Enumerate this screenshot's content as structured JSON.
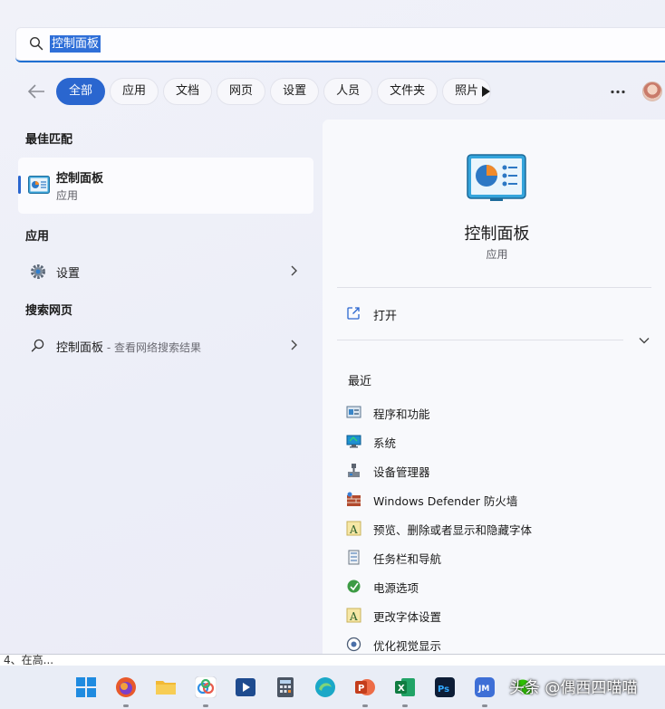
{
  "search": {
    "query": "控制面板"
  },
  "filters": {
    "tabs": [
      "全部",
      "应用",
      "文档",
      "网页",
      "设置",
      "人员",
      "文件夹",
      "照片"
    ],
    "active_index": 0
  },
  "left": {
    "best_match_title": "最佳匹配",
    "best_match": {
      "name": "控制面板",
      "type": "应用"
    },
    "apps_title": "应用",
    "apps": [
      {
        "name": "设置",
        "icon": "gear-icon"
      }
    ],
    "web_title": "搜索网页",
    "web": {
      "query": "控制面板",
      "hint": " - 查看网络搜索结果"
    }
  },
  "detail": {
    "name": "控制面板",
    "type": "应用",
    "open_label": "打开",
    "recent_title": "最近",
    "recent": [
      {
        "label": "程序和功能",
        "icon": "programs-icon"
      },
      {
        "label": "系统",
        "icon": "system-icon"
      },
      {
        "label": "设备管理器",
        "icon": "device-manager-icon"
      },
      {
        "label": "Windows Defender 防火墙",
        "icon": "firewall-icon"
      },
      {
        "label": "预览、删除或者显示和隐藏字体",
        "icon": "font-icon"
      },
      {
        "label": "任务栏和导航",
        "icon": "taskbar-icon"
      },
      {
        "label": "电源选项",
        "icon": "power-icon"
      },
      {
        "label": "更改字体设置",
        "icon": "font-icon"
      },
      {
        "label": "优化视觉显示",
        "icon": "ease-of-access-icon"
      }
    ]
  },
  "bottom_text": "4、在高...",
  "taskbar": {
    "apps": [
      "windows-start-icon",
      "firefox-icon",
      "file-explorer-icon",
      "baidu-netdisk-icon",
      "video-editor-icon",
      "calculator-icon",
      "edge-like-icon",
      "powerpoint-icon",
      "excel-icon",
      "photoshop-icon",
      "jm-app-icon",
      "wechat-icon"
    ],
    "watermark": "头条 @偶西四喵喵"
  },
  "colors": {
    "accent": "#2a66cf",
    "selection": "#2f6fd8"
  }
}
